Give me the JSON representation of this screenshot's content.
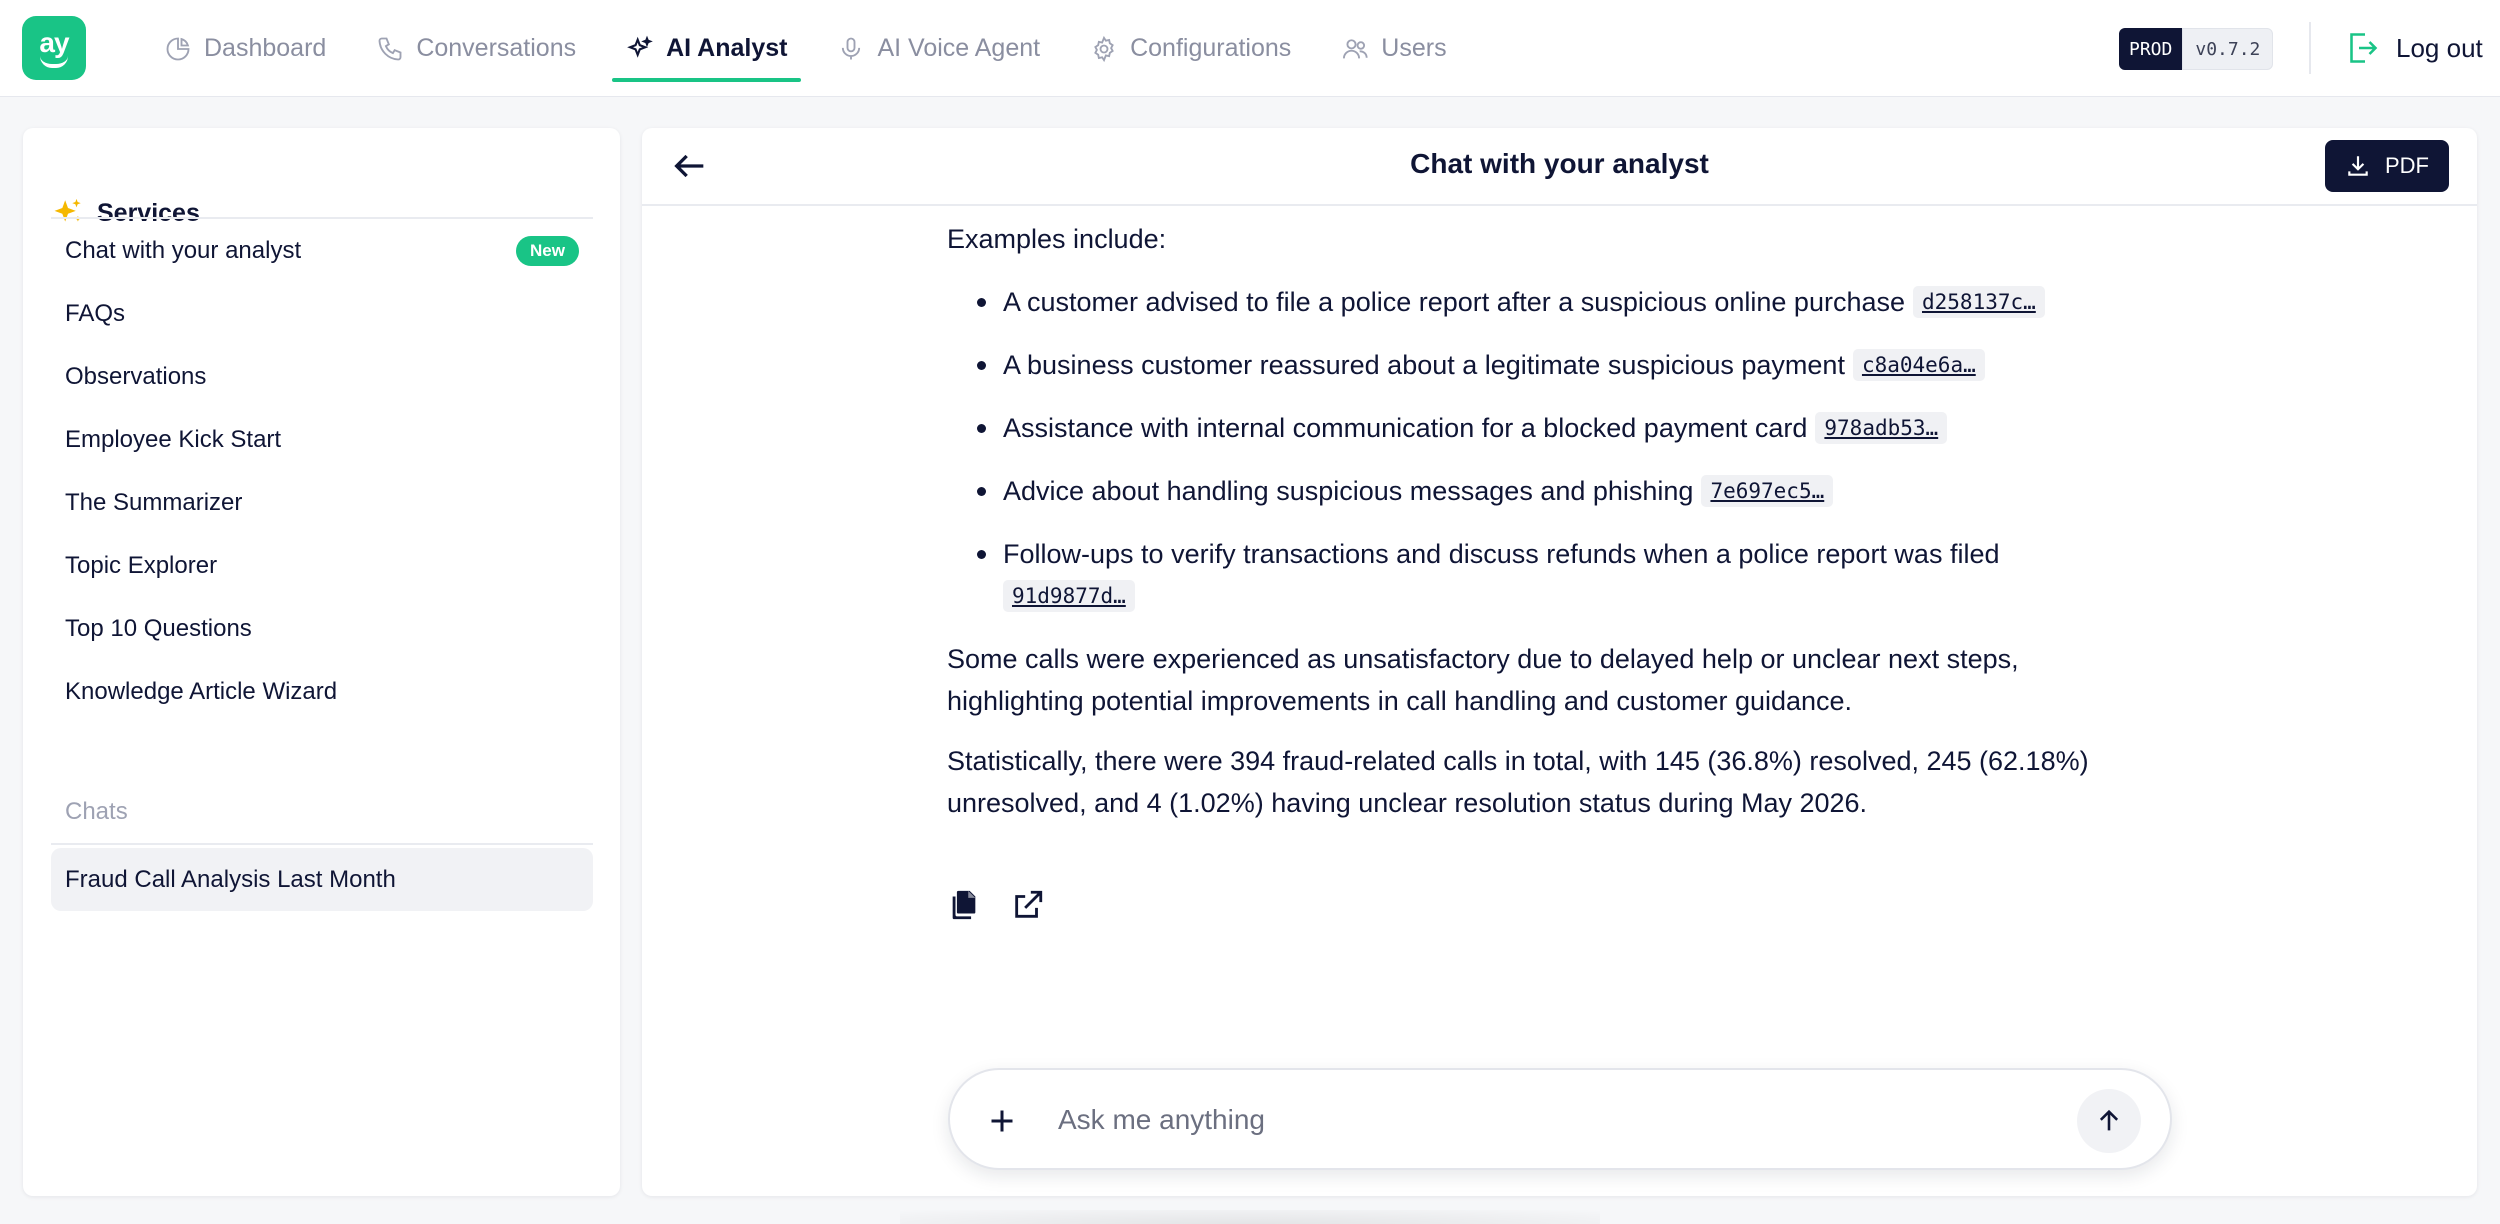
{
  "app": {
    "logo_text": "ay",
    "nav": [
      {
        "label": "Dashboard",
        "icon": "pie-chart-icon"
      },
      {
        "label": "Conversations",
        "icon": "phone-icon"
      },
      {
        "label": "AI Analyst",
        "icon": "sparkles-icon",
        "active": true
      },
      {
        "label": "AI Voice Agent",
        "icon": "microphone-icon"
      },
      {
        "label": "Configurations",
        "icon": "gear-icon"
      },
      {
        "label": "Users",
        "icon": "users-icon"
      }
    ],
    "env_label": "PROD",
    "version": "v0.7.2",
    "logout_label": "Log out",
    "accent_color": "#19c486",
    "primary_color": "#0f1535"
  },
  "sidebar": {
    "services_title": "Services",
    "services_icon": "sparkles-icon",
    "items": [
      {
        "label": "Chat with your analyst",
        "badge": "New"
      },
      {
        "label": "FAQs"
      },
      {
        "label": "Observations"
      },
      {
        "label": "Employee Kick Start"
      },
      {
        "label": "The Summarizer"
      },
      {
        "label": "Topic Explorer"
      },
      {
        "label": "Top 10 Questions"
      },
      {
        "label": "Knowledge Article Wizard"
      }
    ],
    "chats_title": "Chats",
    "chats": [
      {
        "label": "Fraud Call Analysis Last Month",
        "selected": true
      }
    ]
  },
  "main": {
    "title": "Chat with your analyst",
    "pdf_label": "PDF",
    "intro": "Examples include:",
    "examples": [
      {
        "text": "A customer advised to file a police report after a suspicious online purchase",
        "ref": "d258137c…"
      },
      {
        "text": "A business customer reassured about a legitimate suspicious payment",
        "ref": "c8a04e6a…"
      },
      {
        "text": "Assistance with internal communication for a blocked payment card",
        "ref": "978adb53…"
      },
      {
        "text": "Advice about handling suspicious messages and phishing",
        "ref": "7e697ec5…"
      },
      {
        "text": "Follow-ups to verify transactions and discuss refunds when a police report was filed",
        "ref": "91d9877d…"
      }
    ],
    "paragraph_1": "Some calls were experienced as unsatisfactory due to delayed help or unclear next steps, highlighting potential improvements in call handling and customer guidance.",
    "paragraph_2": "Statistically, there were 394 fraud-related calls in total, with 145 (36.8%) resolved, 245 (62.18%) unresolved, and 4 (1.02%) having unclear resolution status during May 2026.",
    "input_placeholder": "Ask me anything"
  }
}
